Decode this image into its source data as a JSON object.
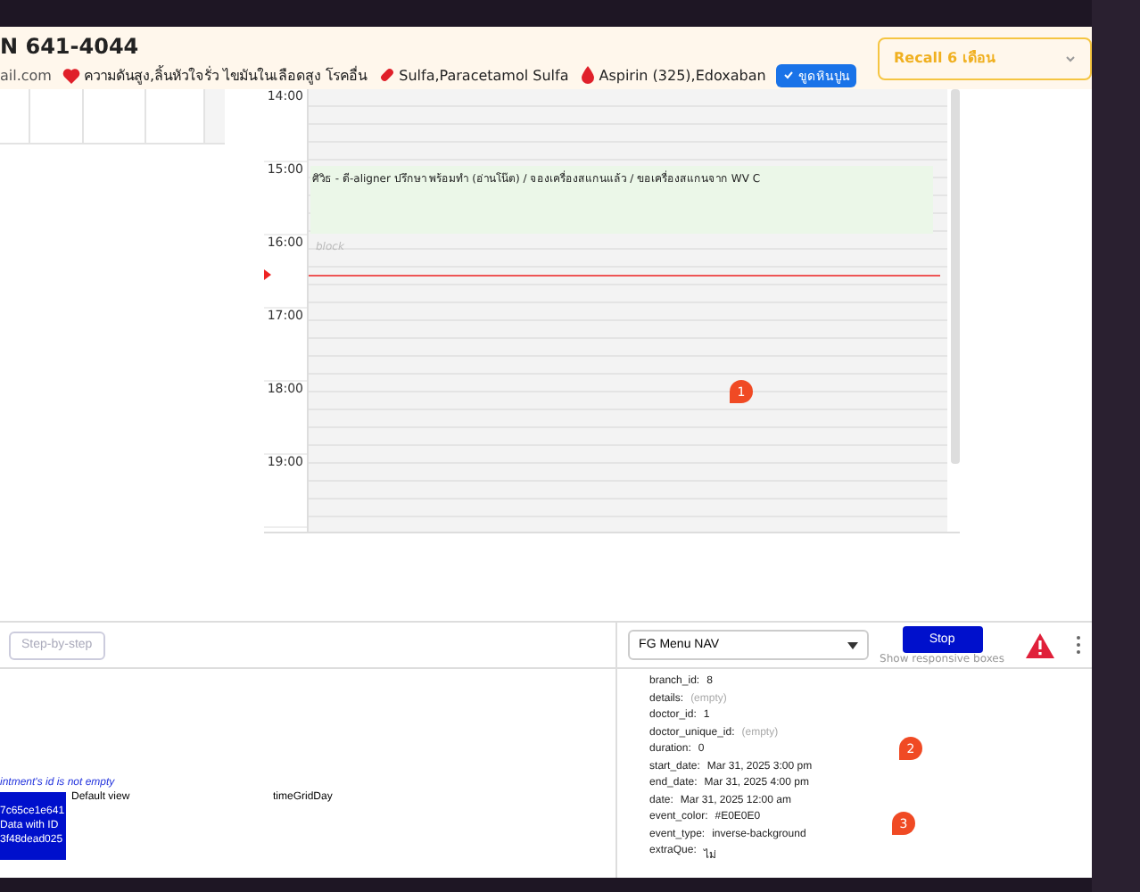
{
  "header": {
    "title": "N 641-4044",
    "email": "ail.com",
    "tags": [
      {
        "kind": "disease",
        "text": "ความดันสูง,ลิ้นหัวใจรั่ว ไขมันในเลือดสูง โรคอื่น"
      },
      {
        "kind": "allergy",
        "text": "Sulfa,Paracetamol Sulfa"
      },
      {
        "kind": "drug",
        "text": "Aspirin (325),Edoxaban"
      }
    ],
    "badge": "ขูดหินปูน",
    "recall": "Recall 6 เดือน"
  },
  "calendar": {
    "hours": [
      "14:00",
      "15:00",
      "16:00",
      "17:00",
      "18:00",
      "19:00"
    ],
    "event": "ศิวิธ - ดี-aligner ปรึกษา พร้อมทำ (อ่านโน๊ต) / จองเครื่องสแกนแล้ว / ขอเครื่องสแกนจาก WV C",
    "block": "block"
  },
  "markers": [
    "1",
    "2",
    "3"
  ],
  "debug": {
    "step_button": "Step-by-step",
    "message": "intment's id is not empty",
    "id_cell": [
      "7c65ce1e641",
      "Data with ID",
      "3f48dead025"
    ],
    "row": [
      "Default view",
      "timeGridDay"
    ],
    "menu_select": "FG Menu NAV",
    "stop_button": "Stop",
    "stop_hint": "Show responsive boxes",
    "fields": [
      {
        "key": "branch_id:",
        "value": "8",
        "empty": false
      },
      {
        "key": "details:",
        "value": "(empty)",
        "empty": true
      },
      {
        "key": "doctor_id:",
        "value": "1",
        "empty": false
      },
      {
        "key": "doctor_unique_id:",
        "value": "(empty)",
        "empty": true
      },
      {
        "key": "duration:",
        "value": "0",
        "empty": false
      },
      {
        "key": "start_date:",
        "value": "Mar 31, 2025 3:00 pm",
        "empty": false
      },
      {
        "key": "end_date:",
        "value": "Mar 31, 2025 4:00 pm",
        "empty": false
      },
      {
        "key": "date:",
        "value": "Mar 31, 2025 12:00 am",
        "empty": false
      },
      {
        "key": "event_color:",
        "value": "#E0E0E0",
        "empty": false
      },
      {
        "key": "event_type:",
        "value": "inverse-background",
        "empty": false
      },
      {
        "key": "extraQue:",
        "value": "ไม่",
        "empty": false
      }
    ]
  }
}
